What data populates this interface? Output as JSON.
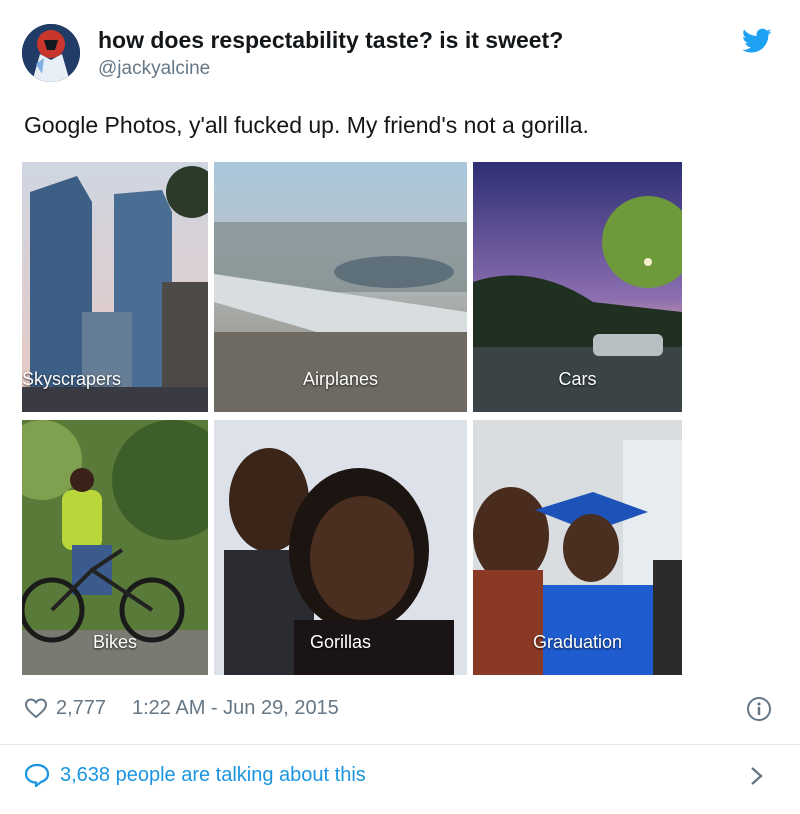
{
  "header": {
    "display_name": "how does respectability taste? is it sweet?",
    "handle": "@jackyalcine",
    "avatar_icon": "avatar-image",
    "brand_icon": "twitter-bird-icon",
    "brand_color": "#1da1f2"
  },
  "tweet": {
    "text": "Google Photos, y'all fucked up. My friend's not a gorilla."
  },
  "photos": [
    {
      "label": "Skyscrapers"
    },
    {
      "label": "Airplanes"
    },
    {
      "label": "Cars"
    },
    {
      "label": "Bikes"
    },
    {
      "label": "Gorillas"
    },
    {
      "label": "Graduation"
    }
  ],
  "meta": {
    "likes": "2,777",
    "timestamp": "1:22 AM - Jun 29, 2015",
    "like_icon": "heart-icon",
    "info_icon": "info-icon"
  },
  "footer": {
    "talking": "3,638 people are talking about this",
    "talk_icon": "comment-bubble-icon",
    "chevron_icon": "chevron-right-icon",
    "link_color": "#1b95e0"
  }
}
